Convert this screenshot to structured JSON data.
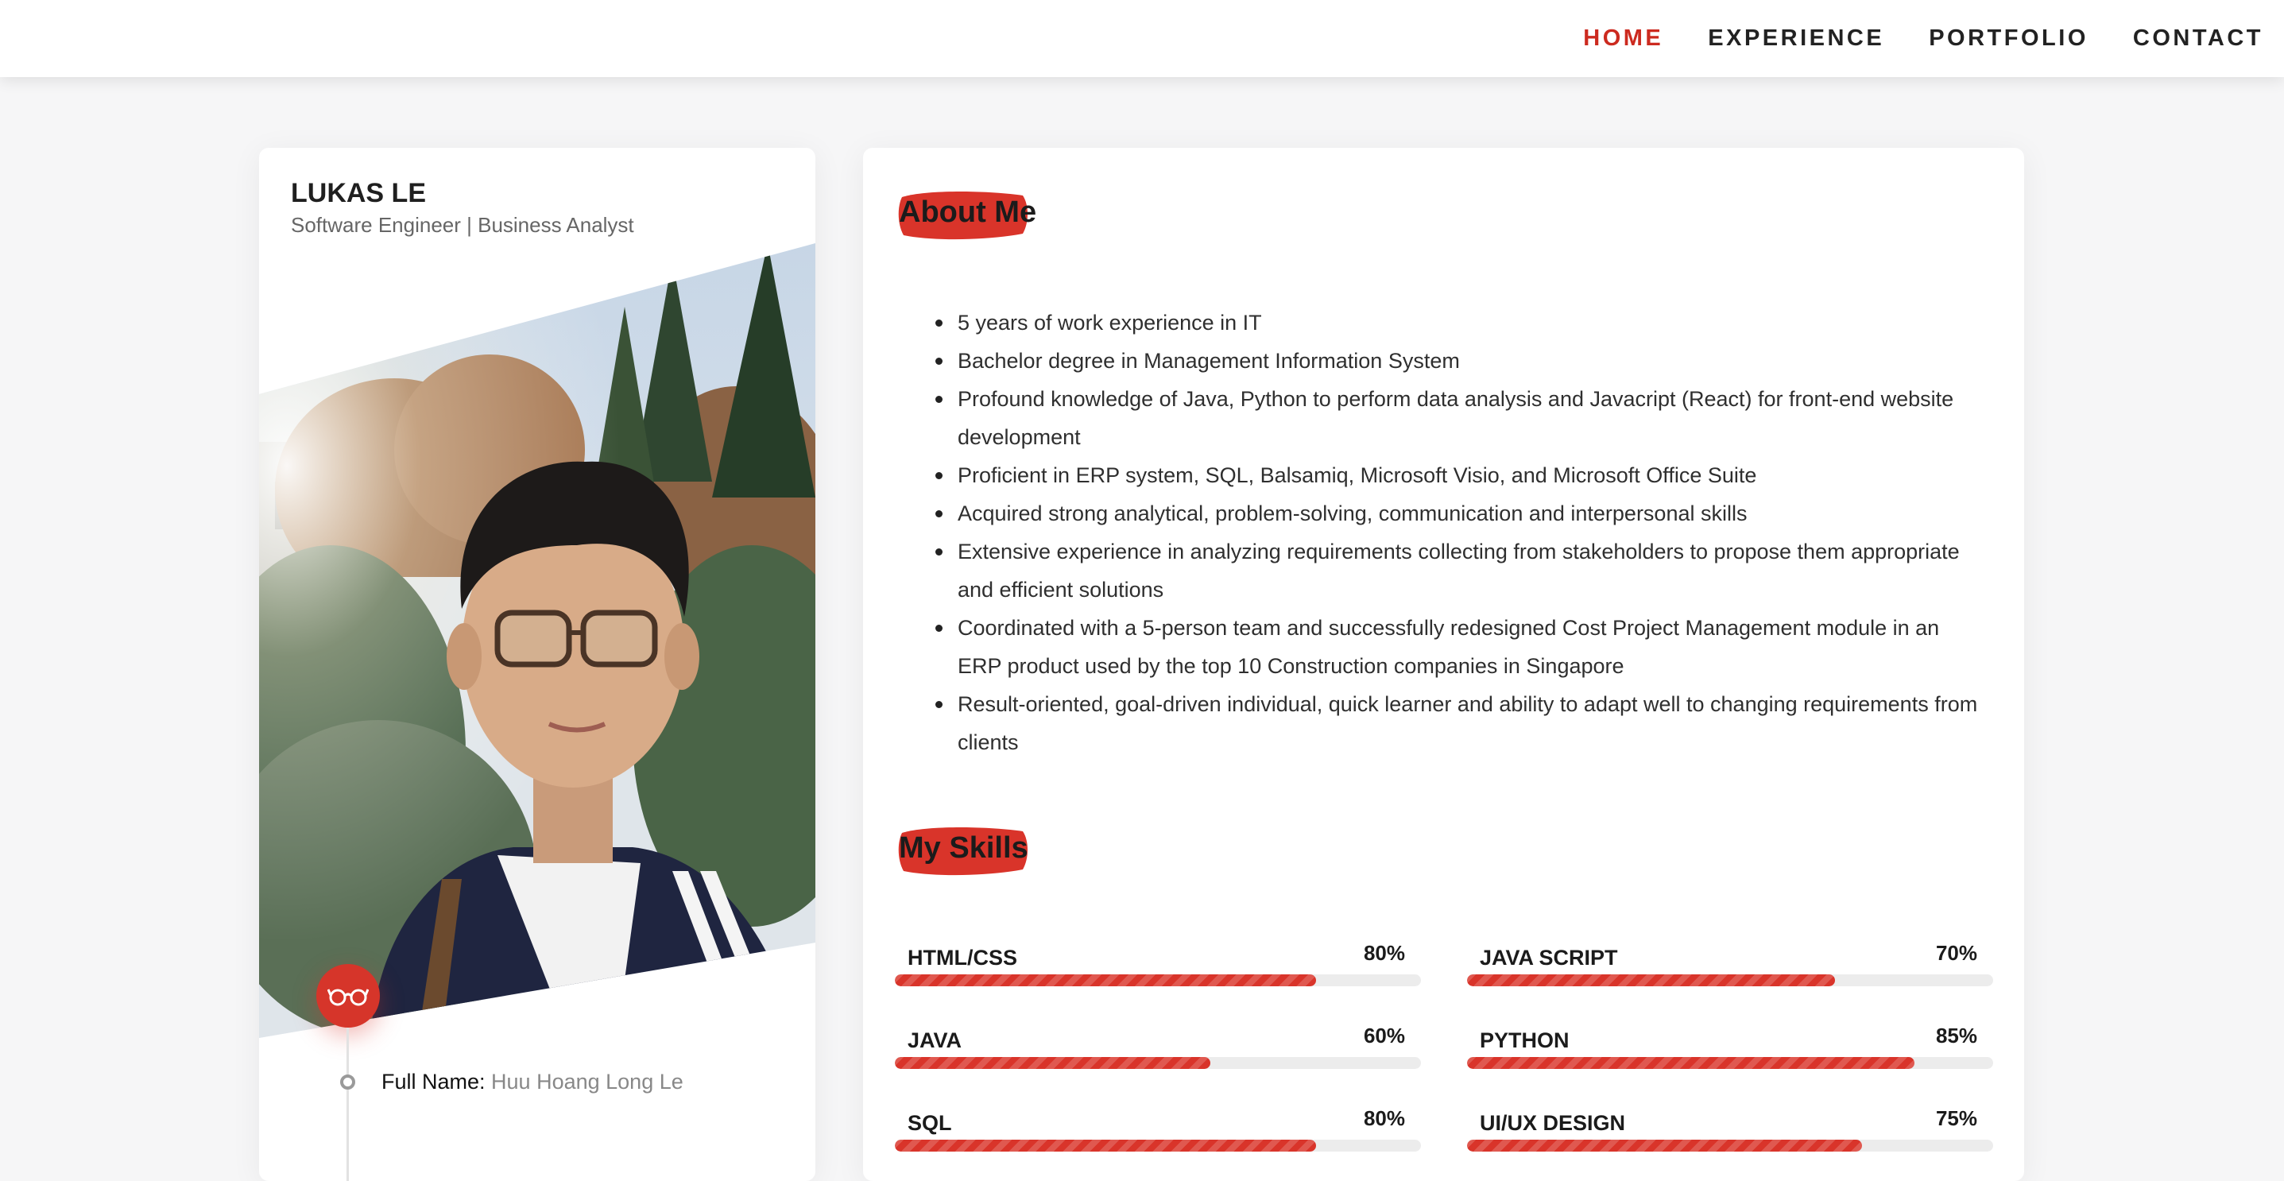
{
  "nav": {
    "items": [
      {
        "label": "HOME",
        "active": true
      },
      {
        "label": "EXPERIENCE",
        "active": false
      },
      {
        "label": "PORTFOLIO",
        "active": false
      },
      {
        "label": "CONTACT",
        "active": false
      }
    ]
  },
  "profile": {
    "name": "LUKAS LE",
    "role": "Software Engineer | Business Analyst",
    "photo": "profile-photo",
    "badge_icon": "glasses-icon",
    "info": {
      "full_name_label": "Full Name:",
      "full_name_value": "Huu Hoang Long Le"
    }
  },
  "about": {
    "title": "About Me",
    "items": [
      "5 years of work experience in IT",
      "Bachelor degree in Management Information System",
      "Profound knowledge of Java, Python to perform data analysis and Javacript (React) for front-end website development",
      "Proficient in ERP system, SQL, Balsamiq, Microsoft Visio, and Microsoft Office Suite",
      "Acquired strong analytical, problem-solving, communication and interpersonal skills",
      "Extensive experience in analyzing requirements collecting from stakeholders to propose them appropriate and efficient solutions",
      "Coordinated with a 5-person team and successfully redesigned Cost Project Management module in an ERP product used by the top 10 Construction companies in Singapore",
      "Result-oriented, goal-driven individual, quick learner and ability to adapt well to changing requirements from clients"
    ]
  },
  "skills": {
    "title": "My Skills",
    "items": [
      {
        "name": "HTML/CSS",
        "percent_label": "80%",
        "level": 80
      },
      {
        "name": "JAVA SCRIPT",
        "percent_label": "70%",
        "level": 70
      },
      {
        "name": "JAVA",
        "percent_label": "60%",
        "level": 60
      },
      {
        "name": "PYTHON",
        "percent_label": "85%",
        "level": 85
      },
      {
        "name": "SQL",
        "percent_label": "80%",
        "level": 80
      },
      {
        "name": "UI/UX DESIGN",
        "percent_label": "75%",
        "level": 75
      }
    ]
  },
  "colors": {
    "accent": "#d6352a",
    "nav_active": "#cc2a1f",
    "bar_fill": "#d9342a",
    "bar_track": "#ececec",
    "background": "#f6f6f7"
  }
}
